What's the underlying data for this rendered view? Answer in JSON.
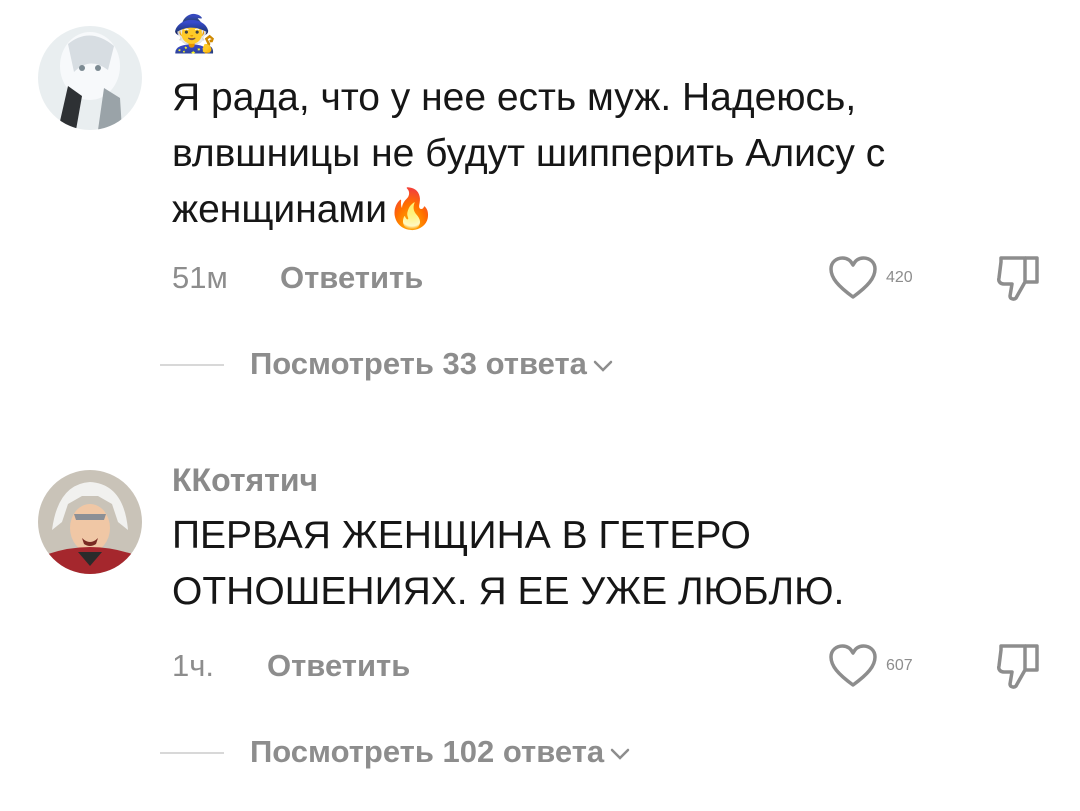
{
  "comments": [
    {
      "author_emoji": "🧙",
      "text": "Я рада, что у нее есть муж. Надеюсь, влвшницы не будут шипперить Алису с женщинами🔥",
      "time": "51м",
      "reply_label": "Ответить",
      "likes": "420",
      "view_replies": "Посмотреть 33 ответа"
    },
    {
      "author": "ККотятич",
      "text": "ПЕРВАЯ ЖЕНЩИНА В ГЕТЕРО ОТНОШЕНИЯХ. Я ЕЕ УЖЕ ЛЮБЛЮ.",
      "time": "1ч.",
      "reply_label": "Ответить",
      "likes": "607",
      "view_replies": "Посмотреть 102 ответа"
    }
  ],
  "icons": {
    "like": "heart-outline-icon",
    "dislike": "thumbs-down-outline-icon",
    "expand": "chevron-down-icon"
  },
  "colors": {
    "text": "#161616",
    "muted": "#8d8d8d",
    "divider": "#d8d8d8"
  }
}
